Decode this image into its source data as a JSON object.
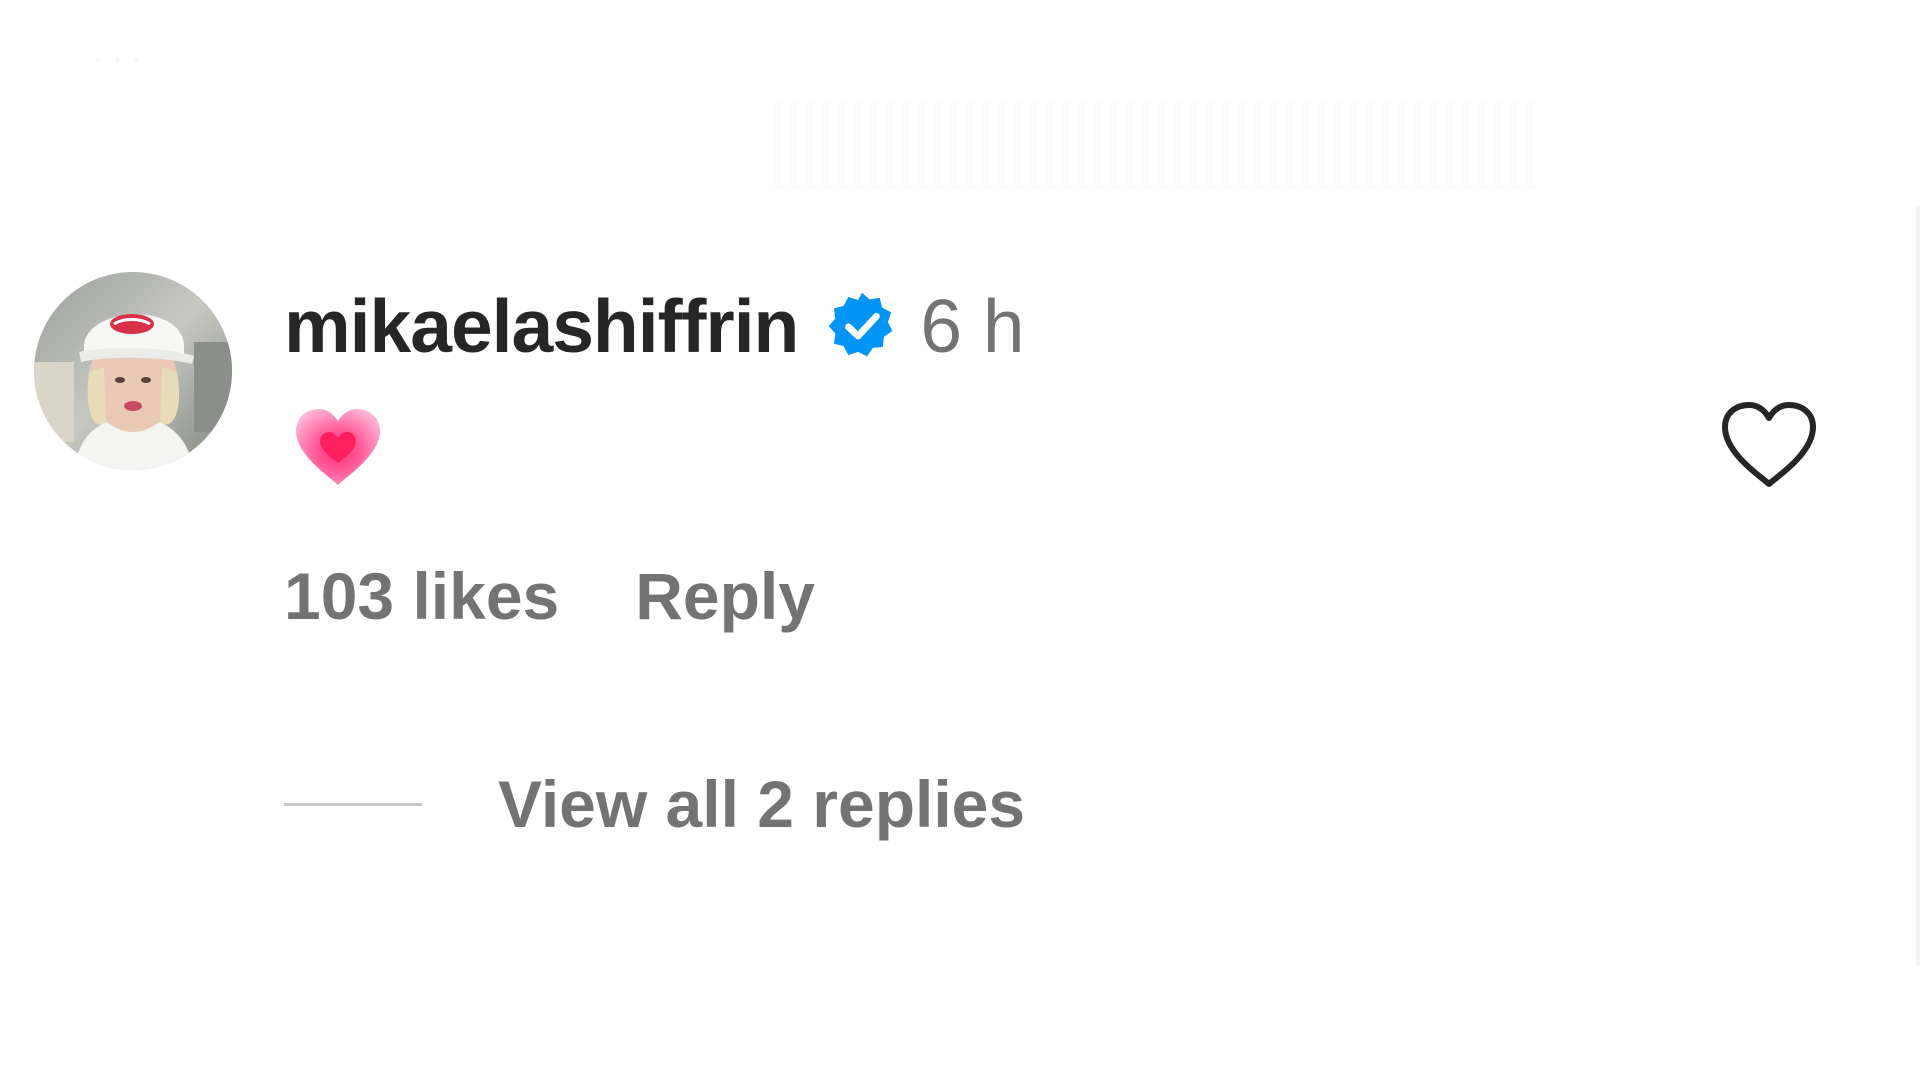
{
  "comment": {
    "username": "mikaelashiffrin",
    "verified": true,
    "timestamp": "6 h",
    "emoji": "pink-heart-emoji",
    "likes_label": "103 likes",
    "reply_label": "Reply",
    "view_replies_label": "View all 2 replies"
  },
  "colors": {
    "username": "#262626",
    "secondary_text": "#737373",
    "verified_badge": "#0095f6",
    "replies_line": "#c7c7c7",
    "heart_outline": "#262626"
  },
  "icons": {
    "verified": "verified-badge-icon",
    "like": "heart-outline-icon"
  }
}
